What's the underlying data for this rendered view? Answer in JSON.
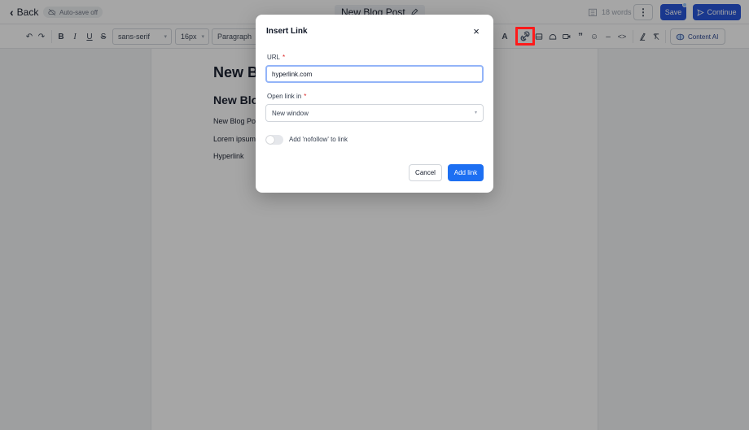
{
  "header": {
    "back_label": "Back",
    "autosave_label": "Auto-save off",
    "title": "New Blog Post",
    "word_count": "18 words",
    "more_label": "⋮",
    "save_label": "Save",
    "continue_label": "Continue"
  },
  "toolbar": {
    "font_family": "sans-serif",
    "font_size": "16px",
    "block_type": "Paragraph",
    "content_ai_label": "Content AI",
    "icons": [
      "undo-icon",
      "redo-icon",
      "bold-icon",
      "italic-icon",
      "underline-icon",
      "strikethrough-icon",
      "text-color-icon",
      "link-icon",
      "image-icon",
      "embed-icon",
      "video-icon",
      "quote-icon",
      "emoji-icon",
      "horizontal-rule-icon",
      "code-icon",
      "highlight-icon",
      "clear-format-icon"
    ]
  },
  "editor": {
    "h1": "New B",
    "h2": "New Blo",
    "p1": "New Blog Pos",
    "p2": "Lorem ipsum",
    "p3": "Hyperlink"
  },
  "modal": {
    "title": "Insert Link",
    "close_label": "×",
    "url_label": "URL",
    "required_mark": "*",
    "url_value": "hyperlink.com",
    "open_in_label": "Open link in",
    "open_in_value": "New window",
    "nofollow_label": "Add 'nofollow' to link",
    "nofollow_on": false,
    "cancel_label": "Cancel",
    "add_label": "Add link"
  },
  "colors": {
    "primary": "#1d4ed8",
    "add_button": "#1d6ff2",
    "highlight_box": "#ff1a1a",
    "overlay": "rgba(20,20,20,0.38)"
  }
}
